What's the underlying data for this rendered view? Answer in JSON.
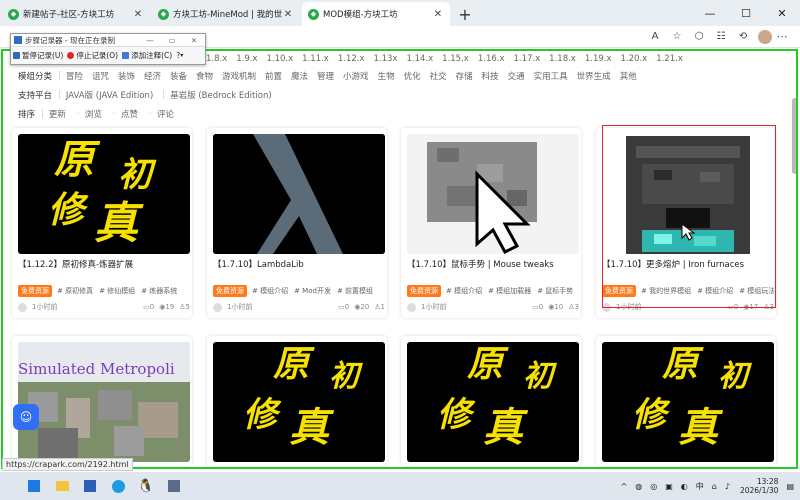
{
  "browser": {
    "tabs": [
      {
        "label": "新建帖子-社区-方块工坊",
        "active": false
      },
      {
        "label": "方块工坊-MineMod | 我的世界玩家社区",
        "active": false
      },
      {
        "label": "MOD模组-方块工坊",
        "active": true
      }
    ],
    "new_tab": "+",
    "controls": {
      "minimize": "—",
      "maximize": "☐",
      "close": "✕"
    },
    "toolbar_icons": [
      "read-aloud-icon",
      "favorite-star-icon",
      "extensions-icon",
      "collections-icon",
      "history-icon",
      "profile-avatar",
      "more-icon"
    ]
  },
  "recorder": {
    "title": "步骤记录器 - 现在正在录制",
    "pause": "暂停记录(U)",
    "stop": "停止记录(O)",
    "comment": "添加注释(C)",
    "help": "?"
  },
  "filters": {
    "versions_label": "",
    "versions": [
      "1.8.x",
      "1.9.x",
      "1.10.x",
      "1.11.x",
      "1.12.x",
      "1.13x",
      "1.14.x",
      "1.15.x",
      "1.16.x",
      "1.17.x",
      "1.18.x",
      "1.19.x",
      "1.20.x",
      "1.21.x"
    ],
    "category_label": "模组分类",
    "categories": [
      "冒险",
      "诅咒",
      "装饰",
      "经济",
      "装备",
      "食物",
      "游戏机制",
      "前置",
      "魔法",
      "管理",
      "小游戏",
      "生物",
      "优化",
      "社交",
      "存储",
      "科技",
      "交通",
      "实用工具",
      "世界生成",
      "其他"
    ],
    "platform_label": "支持平台",
    "platforms": [
      "JAVA版 (JAVA Edition)",
      "基岩版 (Bedrock Edition)"
    ],
    "sort_label": "排序",
    "sorts": [
      "更新",
      "浏览",
      "点赞",
      "评论"
    ]
  },
  "cards": [
    {
      "title": "【1.12.2】原初修真-炼器扩展",
      "badge": "免费资源",
      "tags": [
        "# 原初修真",
        "# 修仙模组",
        "# 炼器系统"
      ],
      "time": "1小时前",
      "comments": "0",
      "views": "19",
      "likes": "5",
      "thumb": "calligraphy"
    },
    {
      "title": "【1.7.10】LambdaLib",
      "badge": "免费资源",
      "tags": [
        "# 模组介绍",
        "# Mod开发",
        "# 前置模组"
      ],
      "time": "1小时前",
      "comments": "0",
      "views": "20",
      "likes": "1",
      "thumb": "lambda"
    },
    {
      "title": "【1.7.10】鼠标手势 | Mouse tweaks",
      "badge": "免费资源",
      "tags": [
        "# 模组介绍",
        "# 模组加载器",
        "# 鼠标手势"
      ],
      "time": "1小时前",
      "comments": "0",
      "views": "10",
      "likes": "3",
      "thumb": "cursor"
    },
    {
      "title": "【1.7.10】更多熔炉 | Iron furnaces",
      "badge": "免费资源",
      "tags": [
        "# 我的世界模组",
        "# 模组介绍",
        "# 模组玩法"
      ],
      "time": "1小时前",
      "comments": "0",
      "views": "17",
      "likes": "3",
      "thumb": "furnace"
    },
    {
      "title": "",
      "thumb": "metropolis",
      "thumb_text": "Simulated Metropoli"
    },
    {
      "title": "",
      "thumb": "calligraphy"
    },
    {
      "title": "",
      "thumb": "calligraphy"
    },
    {
      "title": "",
      "thumb": "calligraphy"
    }
  ],
  "calligraphy": {
    "c1": "原",
    "c2": "初",
    "c3": "修",
    "c4": "真"
  },
  "status_url": "https://crapark.com/2192.html",
  "taskbar": {
    "time": "13:28",
    "date": "2026/1/30",
    "ime": "中",
    "tray_arrow": "^"
  },
  "colors": {
    "highlight_frame": "#22cc22",
    "selection_box": "#e0262c",
    "free_badge": "#ff7a1a",
    "calligraphy_text": "#f6e100"
  }
}
